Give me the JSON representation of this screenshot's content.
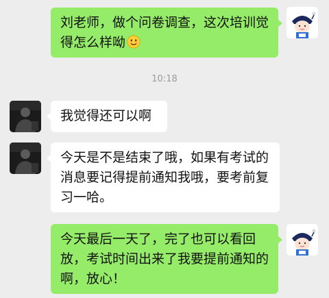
{
  "messages": [
    {
      "direction": "outgoing",
      "sender_avatar": "cartoon-student-avatar",
      "text": "刘老师，做个问卷调查，这次培训觉得怎么样呦",
      "emoji": "smiling-face-emoji"
    },
    {
      "direction": "incoming",
      "sender_avatar": "teacher-photo-avatar",
      "text": "我觉得还可以啊"
    },
    {
      "direction": "incoming",
      "sender_avatar": "teacher-photo-avatar",
      "text": "今天是不是结束了哦，如果有考试的消息要记得提前通知我哦，要考前复习一哈。"
    },
    {
      "direction": "outgoing",
      "sender_avatar": "cartoon-student-avatar",
      "text": "今天最后一天了，完了也可以看回放，考试时间出来了我要提前通知的啊，放心！"
    }
  ],
  "timestamp": "10:18",
  "colors": {
    "background": "#ededed",
    "outgoing_bubble": "#95ec69",
    "incoming_bubble": "#ffffff",
    "timestamp_text": "#9b9b9b"
  }
}
